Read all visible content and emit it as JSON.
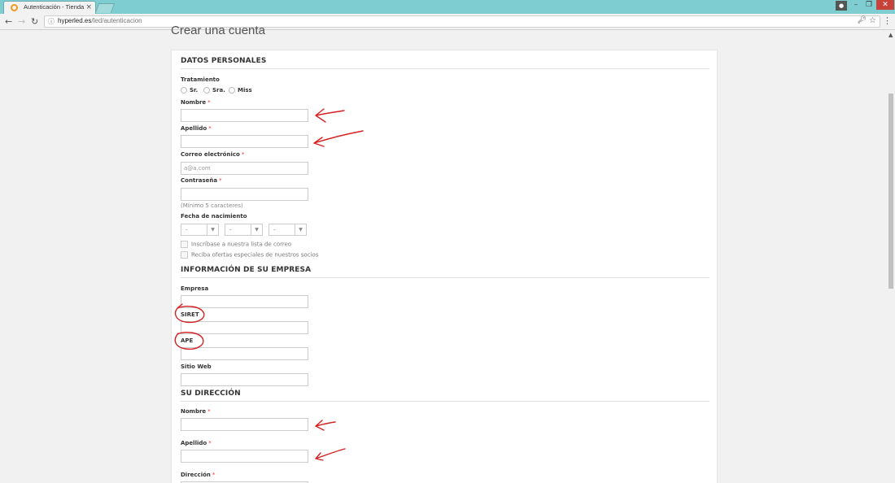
{
  "browser": {
    "tab_title": "Autenticación - Tienda L",
    "tab_close": "×",
    "url_host": "hyperled.es",
    "url_path": "/led/autenticacion",
    "info_icon": "info-icon",
    "win_minimize": "–",
    "win_restore": "❐",
    "win_close": "✕"
  },
  "page": {
    "title": "Crear una cuenta"
  },
  "personal": {
    "heading": "DATOS PERSONALES",
    "tratamiento_label": "Tratamiento",
    "options": [
      "Sr.",
      "Sra.",
      "Miss"
    ],
    "nombre_label": "Nombre",
    "apellido_label": "Apellido",
    "email_label": "Correo electrónico",
    "email_value": "a@a.com",
    "password_label": "Contraseña",
    "password_hint": "(Mínimo 5 caracteres)",
    "birth_label": "Fecha de nacimiento",
    "birth_day": "-",
    "birth_month": "-",
    "birth_year": "-",
    "newsletter_label": "Inscríbase a nuestra lista de correo",
    "offers_label": "Reciba ofertas especiales de nuestros socios",
    "required_mark": "*"
  },
  "company": {
    "heading": "INFORMACIÓN DE SU EMPRESA",
    "empresa_label": "Empresa",
    "siret_label": "SIRET",
    "ape_label": "APE",
    "web_label": "Sitio Web"
  },
  "address": {
    "heading": "SU DIRECCIÓN",
    "nombre_label": "Nombre",
    "apellido_label": "Apellido",
    "direccion_label": "Dirección"
  },
  "colors": {
    "tabbar": "#7ecdd0",
    "annotation": "#d42020",
    "required": "#ee3333"
  }
}
